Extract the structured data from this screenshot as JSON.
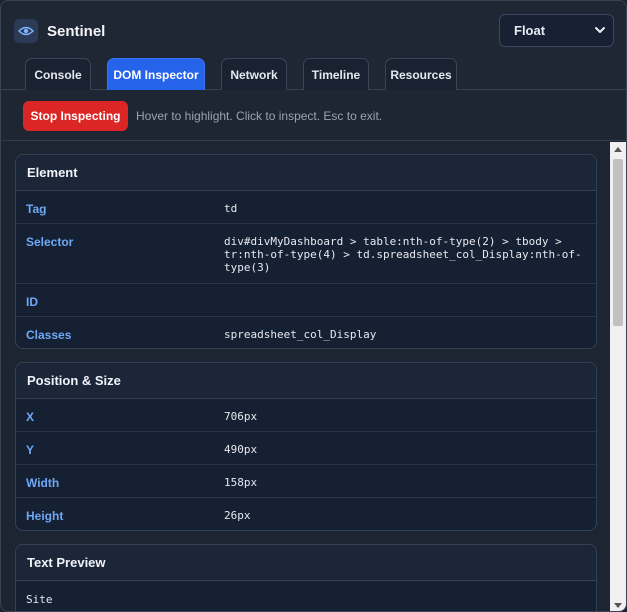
{
  "app": {
    "title": "Sentinel",
    "logo_icon": "eye-icon"
  },
  "mode_select": {
    "value": "Float"
  },
  "tabs": [
    {
      "label": "Console",
      "active": false
    },
    {
      "label": "DOM Inspector",
      "active": true
    },
    {
      "label": "Network",
      "active": false
    },
    {
      "label": "Timeline",
      "active": false
    },
    {
      "label": "Resources",
      "active": false
    }
  ],
  "toolbar": {
    "stop_label": "Stop Inspecting",
    "hint": "Hover to highlight. Click to inspect. Esc to exit."
  },
  "element": {
    "title": "Element",
    "rows": [
      {
        "key": "Tag",
        "value": "td"
      },
      {
        "key": "Selector",
        "value": "div#divMyDashboard > table:nth-of-type(2) > tbody > tr:nth-of-type(4) > td.spreadsheet_col_Display:nth-of-type(3)"
      },
      {
        "key": "ID",
        "value": ""
      },
      {
        "key": "Classes",
        "value": "spreadsheet_col_Display"
      }
    ]
  },
  "position_size": {
    "title": "Position & Size",
    "rows": [
      {
        "key": "X",
        "value": "706px"
      },
      {
        "key": "Y",
        "value": "490px"
      },
      {
        "key": "Width",
        "value": "158px"
      },
      {
        "key": "Height",
        "value": "26px"
      }
    ]
  },
  "text_preview": {
    "title": "Text Preview",
    "value": "Site"
  },
  "colors": {
    "accent": "#2563eb",
    "danger": "#dc2626",
    "key_text": "#6ea8f5"
  }
}
